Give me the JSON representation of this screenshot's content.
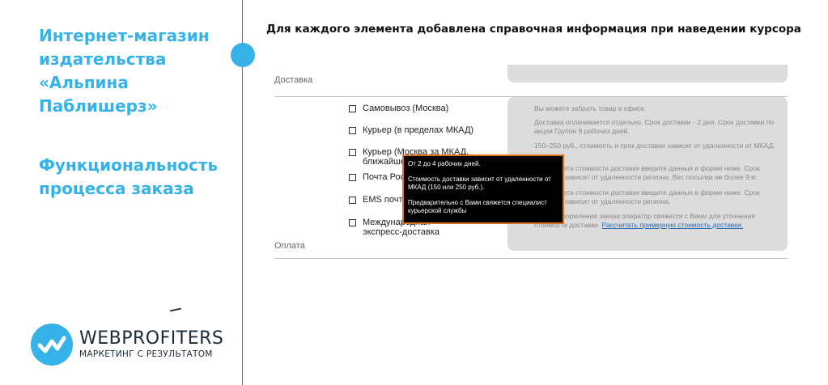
{
  "sidebar": {
    "title_lines": [
      "Интернет-магазин",
      "издательства",
      "«Альпина",
      "Паблишерз»"
    ],
    "subtitle_lines": [
      "Функциональность",
      "процесса заказа"
    ],
    "logo": {
      "name": "WEBPROFITERS",
      "tagline": "МАРКЕТИНГ С РЕЗУЛЬТАТОМ"
    },
    "accent_color": "#35b3e8"
  },
  "main": {
    "heading": "Для каждого элемента добавлена справочная информация при наведении курсора",
    "delivery_label": "Доставка",
    "payment_label": "Оплата",
    "options": [
      {
        "label": "Самовывоз (Москва)"
      },
      {
        "label": "Курьер (в пределах МКАД)"
      },
      {
        "label": "Курьер (Москва за МКАД, ближайшее Подмосковье)"
      },
      {
        "label": "Почта России"
      },
      {
        "label": "EMS почта"
      },
      {
        "label": "Международная экспресс-доставка"
      }
    ],
    "info": [
      {
        "text": "Вы можете забрать товар в офисе."
      },
      {
        "text": "Доставка оплачивается отдельно. Срок доставки - 2 дня. Срок доставки по акции Групон 6 рабочих дней."
      },
      {
        "text": "150–250 руб., стоимость и срок доставки зависит от удаленности от МКАД."
      },
      {
        "text": "Для расчета стоимости доставки введите данные в форме ниже. Срок доставки зависит от удаленности региона. Вес посылки не более 9 кг."
      },
      {
        "text": "Для расчета стоимости доставки введите данные в форме ниже. Срок доставки зависит от удаленности региона."
      },
      {
        "text": "После оформления заказа оператор свяжется с Вами для уточнения стоимости доставки.",
        "link": "Рассчитать примерную стоимость доставки."
      }
    ],
    "tooltip": {
      "line1": "От 2 до 4 рабочих дней.",
      "line2": "Стоимость доставки зависит от удаленности от МКАД (150 или 250 руб.).",
      "line3": "Предварительно с Вами свяжется специалист курьерской службы",
      "border_color": "#d8731f"
    }
  }
}
